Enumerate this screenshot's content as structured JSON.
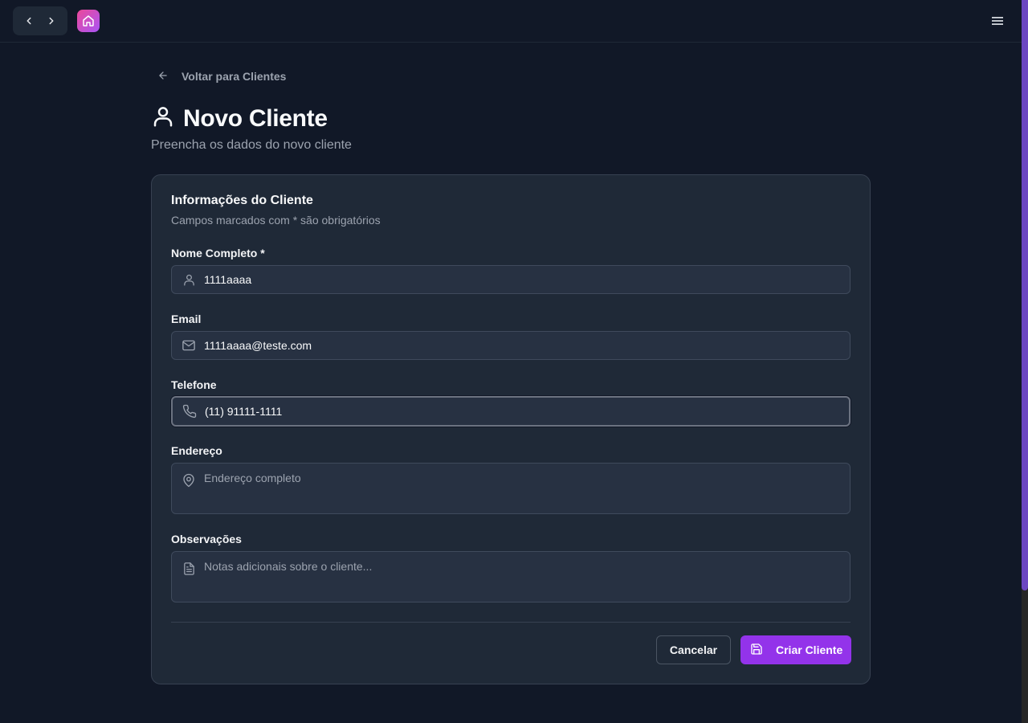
{
  "colors": {
    "background": "#111827",
    "card": "#1f2937",
    "accent": "#9333ea",
    "logo_gradient_start": "#ec4899",
    "logo_gradient_end": "#a855f7"
  },
  "topbar": {
    "back_icon": "chevron-left-icon",
    "forward_icon": "chevron-right-icon",
    "logo_icon": "home-icon",
    "menu_icon": "hamburger-menu-icon"
  },
  "page": {
    "back_link": "Voltar para Clientes",
    "title": "Novo Cliente",
    "subtitle": "Preencha os dados do novo cliente"
  },
  "card": {
    "title": "Informações do Cliente",
    "description": "Campos marcados com * são obrigatórios"
  },
  "form": {
    "name": {
      "label": "Nome Completo *",
      "value": "1111aaaa",
      "icon": "user-icon"
    },
    "email": {
      "label": "Email",
      "value": "1111aaaa@teste.com",
      "icon": "mail-icon"
    },
    "phone": {
      "label": "Telefone",
      "value": "(11) 91111-1111",
      "icon": "phone-icon"
    },
    "address": {
      "label": "Endereço",
      "value": "",
      "placeholder": "Endereço completo",
      "icon": "map-pin-icon"
    },
    "notes": {
      "label": "Observações",
      "value": "",
      "placeholder": "Notas adicionais sobre o cliente...",
      "icon": "file-text-icon"
    }
  },
  "actions": {
    "cancel": "Cancelar",
    "create": "Criar Cliente",
    "create_icon": "save-icon"
  }
}
